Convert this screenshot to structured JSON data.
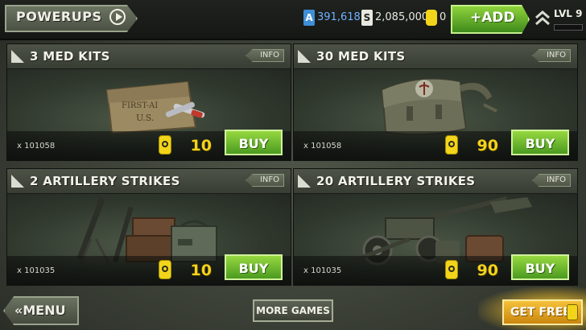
{
  "header": {
    "tab_label": "POWERUPS",
    "currencies": {
      "a": {
        "icon": "A",
        "value": "391,618"
      },
      "s": {
        "icon": "S",
        "value": "2,085,000"
      },
      "gold": {
        "icon": "gold-icon",
        "value": "0"
      }
    },
    "add_label": "+ADD",
    "level_label": "LVL",
    "level_value": "9"
  },
  "cards": [
    {
      "title": "3 MED KITS",
      "info_label": "INFO",
      "stock": "x 101058",
      "price": "10",
      "buy_label": "BUY"
    },
    {
      "title": "30 MED KITS",
      "info_label": "INFO",
      "stock": "x 101058",
      "price": "90",
      "buy_label": "BUY"
    },
    {
      "title": "2 ARTILLERY STRIKES",
      "info_label": "INFO",
      "stock": "x 101035",
      "price": "10",
      "buy_label": "BUY"
    },
    {
      "title": "20 ARTILLERY STRIKES",
      "info_label": "INFO",
      "stock": "x 101035",
      "price": "90",
      "buy_label": "BUY"
    }
  ],
  "art_text": {
    "medkit_pouch": "FIRST-AI",
    "medkit_pouch_2": "U.S."
  },
  "footer": {
    "menu_label": "«MENU",
    "more_games_label": "MORE GAMES",
    "get_free_label": "GET FREE"
  },
  "colors": {
    "accent_green": "#6dbb2e",
    "gold": "#f5d21c",
    "currency_blue": "#3e8ed8"
  }
}
